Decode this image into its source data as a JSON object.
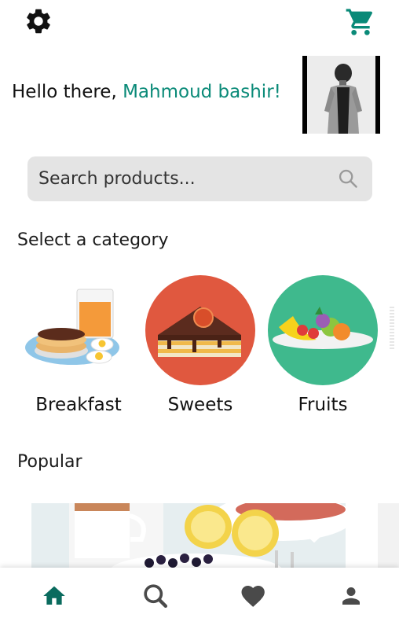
{
  "header": {
    "settings_icon": "gear-icon",
    "cart_icon": "shopping-cart-icon",
    "accent_color": "#0a8a78"
  },
  "greeting": {
    "prefix": "Hello there, ",
    "name": "Mahmoud bashir",
    "suffix": "!"
  },
  "search": {
    "placeholder": "Search products...",
    "icon": "search-icon"
  },
  "categories": {
    "title": "Select a category",
    "items": [
      {
        "label": "Breakfast",
        "image": "breakfast-illustration"
      },
      {
        "label": "Sweets",
        "image": "cake-slice-illustration",
        "bg_color": "#e0583f"
      },
      {
        "label": "Fruits",
        "image": "fruit-plate-illustration",
        "bg_color": "#3fb98d"
      }
    ]
  },
  "popular": {
    "title": "Popular",
    "favorite_icon": "heart-icon"
  },
  "bottom_nav": {
    "items": [
      {
        "name": "home",
        "icon": "home-icon",
        "active": true
      },
      {
        "name": "search",
        "icon": "search-icon",
        "active": false
      },
      {
        "name": "favorites",
        "icon": "heart-icon",
        "active": false
      },
      {
        "name": "profile",
        "icon": "person-icon",
        "active": false
      }
    ],
    "active_color": "#0a6b5e",
    "inactive_color": "#4a4a4a"
  }
}
